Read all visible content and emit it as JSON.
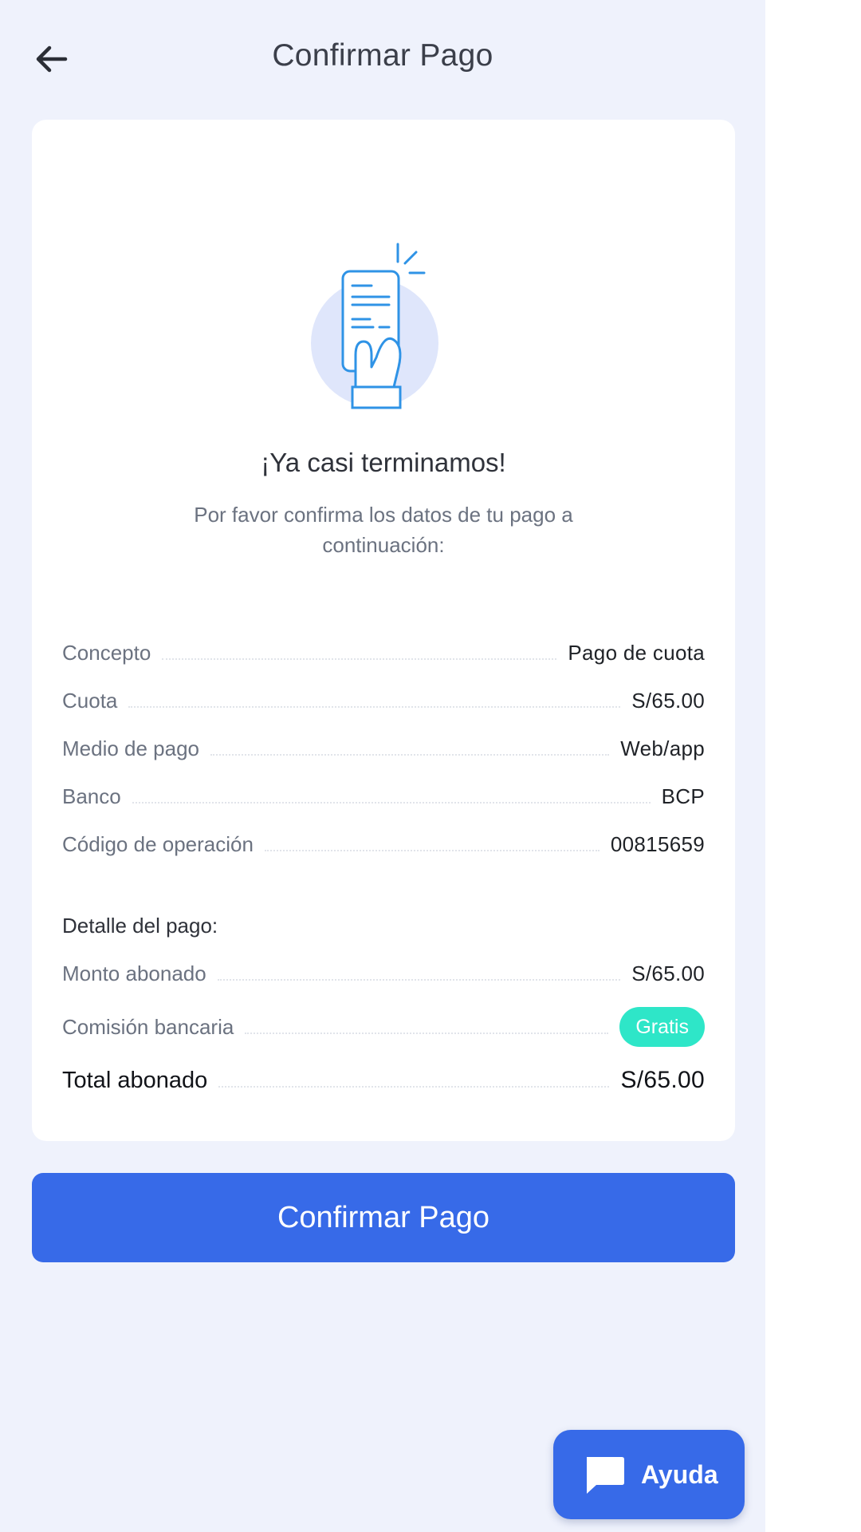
{
  "header": {
    "title": "Confirmar Pago",
    "back_icon": "arrow-left-icon"
  },
  "card": {
    "illustration_icon": "phone-receipt-hand-icon",
    "heading": "¡Ya casi terminamos!",
    "subtitle": "Por favor confirma los datos de tu pago a continuación:",
    "details": [
      {
        "label": "Concepto",
        "value": "Pago de cuota"
      },
      {
        "label": "Cuota",
        "value": "S/65.00"
      },
      {
        "label": "Medio de pago",
        "value": "Web/app"
      },
      {
        "label": "Banco",
        "value": "BCP"
      },
      {
        "label": "Código de operación",
        "value": "00815659"
      }
    ],
    "payment_section_label": "Detalle del pago:",
    "payment": {
      "amount_label": "Monto abonado",
      "amount_value": "S/65.00",
      "fee_label": "Comisión bancaria",
      "fee_badge": "Gratis",
      "total_label": "Total abonado",
      "total_value": "S/65.00"
    }
  },
  "confirm_button": "Confirmar Pago",
  "help_button": {
    "label": "Ayuda",
    "icon": "chat-bubble-icon"
  },
  "colors": {
    "background": "#eff2fc",
    "primary": "#376ae8",
    "badge": "#2ee6c8",
    "card": "#ffffff"
  }
}
